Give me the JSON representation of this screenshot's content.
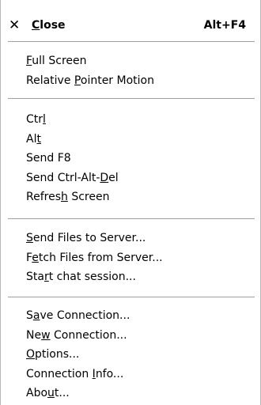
{
  "menu": {
    "close": {
      "icon": "close-x-icon",
      "label_u": "C",
      "label_rest": "lose",
      "shortcut": "Alt+F4"
    },
    "groups": [
      [
        {
          "pre": "",
          "u": "F",
          "post": "ull Screen"
        },
        {
          "pre": "Relative ",
          "u": "P",
          "post": "ointer Motion"
        }
      ],
      [
        {
          "pre": "Ctr",
          "u": "l",
          "post": ""
        },
        {
          "pre": "Al",
          "u": "t",
          "post": ""
        },
        {
          "pre": "Send F8",
          "u": "",
          "post": ""
        },
        {
          "pre": "Send Ctrl-Alt-",
          "u": "D",
          "post": "el"
        },
        {
          "pre": "Refres",
          "u": "h",
          "post": " Screen"
        }
      ],
      [
        {
          "pre": "",
          "u": "S",
          "post": "end Files to Server..."
        },
        {
          "pre": "F",
          "u": "e",
          "post": "tch Files from Server..."
        },
        {
          "pre": "Sta",
          "u": "r",
          "post": "t chat session..."
        }
      ],
      [
        {
          "pre": "S",
          "u": "a",
          "post": "ve Connection..."
        },
        {
          "pre": "Ne",
          "u": "w",
          "post": " Connection..."
        },
        {
          "pre": "",
          "u": "O",
          "post": "ptions..."
        },
        {
          "pre": "Connection ",
          "u": "I",
          "post": "nfo..."
        },
        {
          "pre": "Abo",
          "u": "u",
          "post": "t..."
        }
      ]
    ]
  }
}
